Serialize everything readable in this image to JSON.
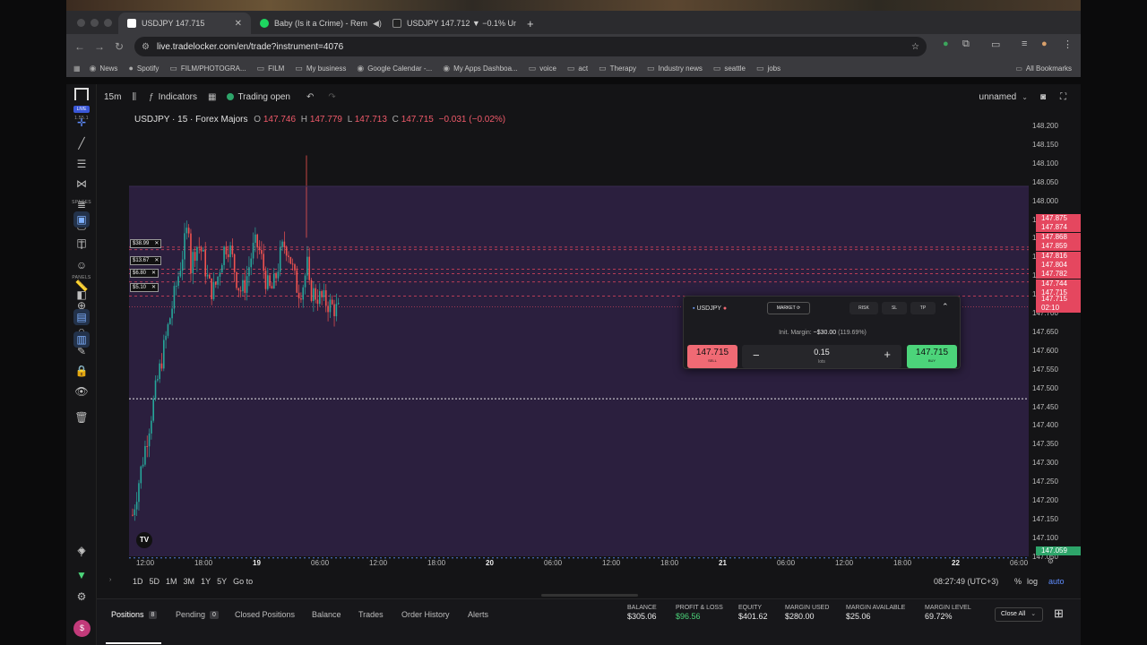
{
  "browser": {
    "tabs": [
      {
        "title": "USDJPY 147.715"
      },
      {
        "title": "Baby (Is it a Crime) - Rem"
      },
      {
        "title": "USDJPY 147.712 ▼ −0.1% Un"
      }
    ],
    "url": "live.tradelocker.com/en/trade?instrument=4076",
    "bookmarks": [
      "News",
      "Spotify",
      "FILM/PHOTOGRA...",
      "FILM",
      "My business",
      "Google Calendar -...",
      "My Apps Dashboa...",
      "voice",
      "act",
      "Therapy",
      "Industry news",
      "seattle",
      "jobs"
    ],
    "all_bookmarks": "All Bookmarks"
  },
  "sidebar": {
    "live_badge": "LIVE",
    "version": "1.55.1",
    "spaces_label": "SPACES",
    "panels_label": "PANELS",
    "avatar_letter": "$"
  },
  "toolbar": {
    "interval": "15m",
    "indicators": "Indicators",
    "trading_status": "Trading open",
    "layout_name": "unnamed"
  },
  "chart": {
    "symbol_line": "USDJPY · 15 · Forex Majors",
    "open_label": "O",
    "open": "147.746",
    "high_label": "H",
    "high": "147.779",
    "low_label": "L",
    "low": "147.713",
    "close_label": "C",
    "close": "147.715",
    "change": "−0.031 (−0.02%)",
    "price_ticks": [
      "148.200",
      "148.150",
      "148.100",
      "148.050",
      "148.000",
      "147.950",
      "147.900",
      "147.850",
      "147.800",
      "147.750",
      "147.700",
      "147.650",
      "147.600",
      "147.550",
      "147.500",
      "147.450",
      "147.400",
      "147.350",
      "147.300",
      "147.250",
      "147.200",
      "147.150",
      "147.100",
      "147.050"
    ],
    "red_labels": [
      "147.875",
      "147.874",
      "147.868",
      "147.859",
      "147.816",
      "147.804",
      "147.782",
      "147.744",
      "147.715"
    ],
    "current_price": "147.715",
    "countdown": "02:10",
    "symbol_tag": "USDJPY",
    "low_tag": "147.059",
    "time_ticks": [
      "12:00",
      "18:00",
      "19",
      "06:00",
      "12:00",
      "18:00",
      "20",
      "06:00",
      "12:00",
      "18:00",
      "21",
      "06:00",
      "12:00",
      "18:00",
      "22",
      "06:00"
    ],
    "order_tags": [
      "$38.99",
      "$13.67",
      "$6.80",
      "$5.10"
    ],
    "watermark": "TV"
  },
  "range": {
    "buttons": [
      "1D",
      "5D",
      "1M",
      "3M",
      "1Y",
      "5Y"
    ],
    "goto": "Go to",
    "clock": "08:27:49 (UTC+3)",
    "percent": "%",
    "log": "log",
    "auto": "auto"
  },
  "trade_panel": {
    "symbol": "USDJPY",
    "order_type": "MARKET",
    "risk": "RISK",
    "sl": "SL",
    "tp": "TP",
    "margin_label": "Init. Margin:",
    "margin_value": "~$30.00",
    "margin_pct": "(119.69%)",
    "sell_price": "147.715",
    "sell_label": "SELL",
    "buy_price": "147.715",
    "buy_label": "BUY",
    "lots_value": "0.15",
    "lots_label": "lots"
  },
  "bottom": {
    "tabs": [
      {
        "label": "Positions",
        "count": "8"
      },
      {
        "label": "Pending",
        "count": "0"
      },
      {
        "label": "Closed Positions"
      },
      {
        "label": "Balance"
      },
      {
        "label": "Trades"
      },
      {
        "label": "Order History"
      },
      {
        "label": "Alerts"
      }
    ],
    "stats": [
      {
        "label": "BALANCE",
        "value": "$305.06"
      },
      {
        "label": "PROFIT & LOSS",
        "value": "$96.56"
      },
      {
        "label": "EQUITY",
        "value": "$401.62"
      },
      {
        "label": "MARGIN USED",
        "value": "$280.00"
      },
      {
        "label": "MARGIN AVAILABLE",
        "value": "$25.06"
      },
      {
        "label": "MARGIN LEVEL",
        "value": "69.72%"
      }
    ],
    "close_all": "Close All"
  },
  "colors": {
    "bull": "#26a69a",
    "bear": "#ef5350",
    "bg_purple": "#2b1f3e",
    "buy_green": "#4cd47a",
    "sell_red": "#f06a74"
  }
}
